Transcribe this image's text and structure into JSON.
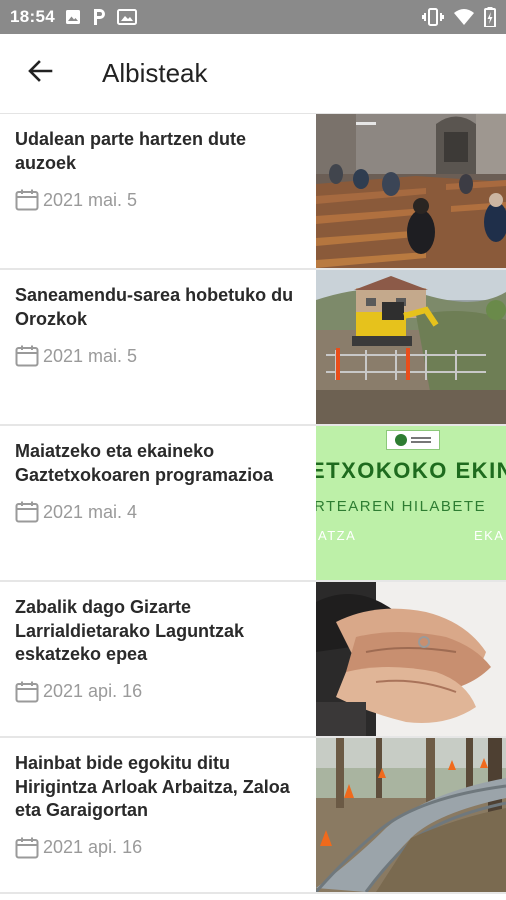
{
  "status_bar": {
    "time": "18:54",
    "left_icons": [
      "image-icon",
      "parking-icon",
      "photo-icon"
    ],
    "right_icons": [
      "vibrate-icon",
      "wifi-icon",
      "battery-icon"
    ]
  },
  "app_bar": {
    "back_icon": "arrow-back-icon",
    "title": "Albisteak"
  },
  "news": [
    {
      "title": "Udalean parte hartzen dute auzoek",
      "date": "2021 mai. 5",
      "thumbnail": "church-interior"
    },
    {
      "title": "Saneamendu-sarea hobetuko du Orozkok",
      "date": "2021 mai. 5",
      "thumbnail": "excavator-works"
    },
    {
      "title": "Maiatzeko eta ekaineko Gaztetxokoaren programazioa",
      "date": "2021 mai. 4",
      "thumbnail": "green-poster",
      "thumb_text": {
        "line1": "ETXOKOKO EKIN",
        "line2": "RTEAREN HILABETE",
        "line3_left": "ATZA",
        "line3_right": "EKA"
      }
    },
    {
      "title": "Zabalik dago Gizarte Larrialdietarako Laguntzak eskatzeko epea",
      "date": "2021 api. 16",
      "thumbnail": "hands"
    },
    {
      "title": "Hainbat bide egokitu ditu Hirigintza Arloak Arbaitza, Zaloa eta Garaigortan",
      "date": "2021 api. 16",
      "thumbnail": "path-cones"
    }
  ]
}
